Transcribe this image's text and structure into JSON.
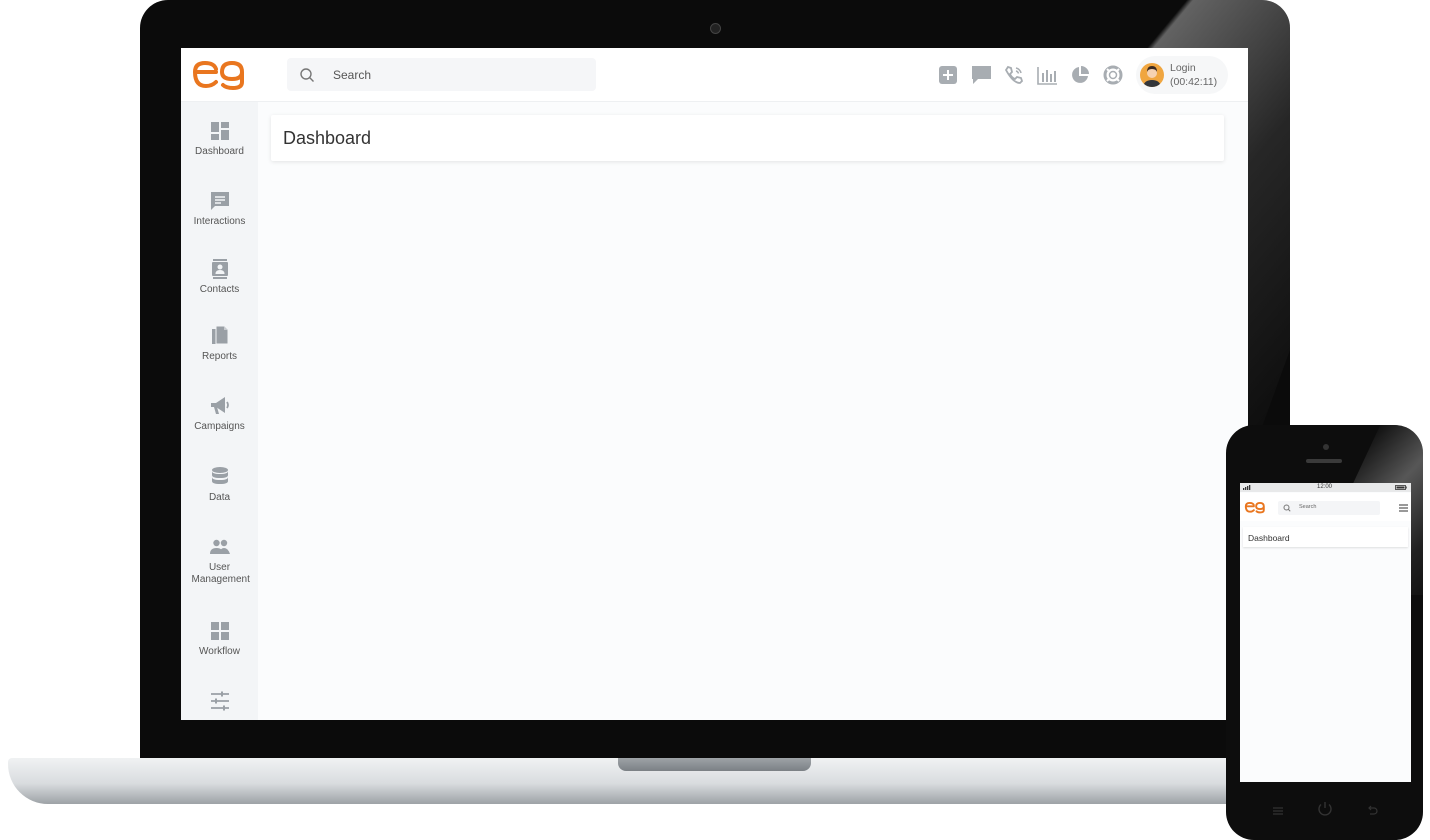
{
  "header": {
    "search_placeholder": "Search",
    "icons": [
      "plus-icon",
      "chat-icon",
      "phone-icon",
      "bar-chart-icon",
      "pie-chart-icon",
      "lifebuoy-icon"
    ],
    "user": {
      "line1": "Login",
      "line2": "(00:42:11)"
    }
  },
  "sidebar": {
    "items": [
      {
        "label": "Dashboard",
        "icon": "dashboard-icon"
      },
      {
        "label": "Interactions",
        "icon": "message-icon"
      },
      {
        "label": "Contacts",
        "icon": "contacts-icon"
      },
      {
        "label": "Reports",
        "icon": "reports-icon"
      },
      {
        "label": "Campaigns",
        "icon": "megaphone-icon"
      },
      {
        "label": "Data",
        "icon": "database-icon"
      },
      {
        "label": "User Management",
        "icon": "users-icon"
      },
      {
        "label": "Workflow",
        "icon": "workflow-icon"
      },
      {
        "label": "",
        "icon": "sliders-icon"
      }
    ]
  },
  "main": {
    "title": "Dashboard"
  },
  "phone": {
    "time": "12:00",
    "search_placeholder": "Search",
    "title": "Dashboard"
  },
  "colors": {
    "brand": "#e9761f",
    "icon_gray": "#9aa0a6",
    "sidebar_bg": "#f3f5f7"
  }
}
